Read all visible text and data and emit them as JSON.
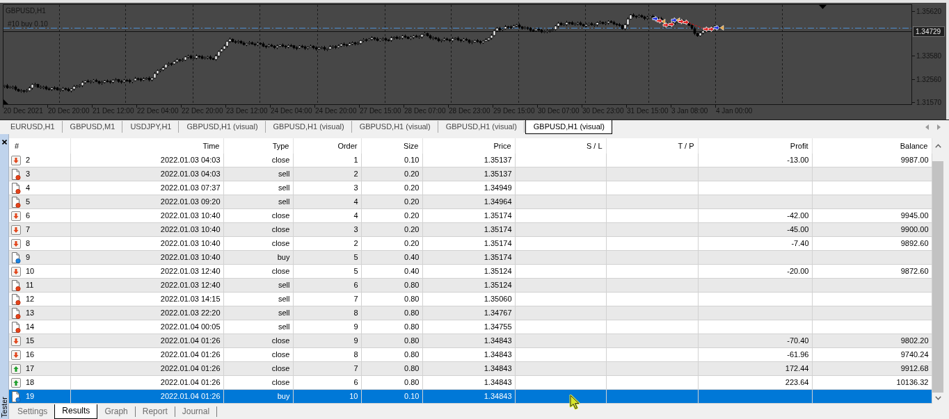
{
  "chart": {
    "symbol_label": "GBPUSD,H1",
    "order_label": "#10 buy 0.10",
    "price_ticks": [
      "1.35620",
      "1.33580",
      "1.32560",
      "1.31570"
    ],
    "current_price": "1.34729",
    "time_labels": [
      "20 Dec 2021",
      "20 Dec 20:00",
      "21 Dec 12:00",
      "22 Dec 04:00",
      "22 Dec 20:00",
      "23 Dec 12:00",
      "24 Dec 04:00",
      "24 Dec 20:00",
      "27 Dec 15:00",
      "28 Dec 07:00",
      "28 Dec 23:00",
      "29 Dec 15:00",
      "30 Dec 07:00",
      "30 Dec 23:00",
      "31 Dec 15:00",
      "3 Jan 08:00",
      "4 Jan 00:00"
    ]
  },
  "chart_tabs": [
    {
      "label": "EURUSD,H1",
      "selected": false
    },
    {
      "label": "GBPUSD,M1",
      "selected": false
    },
    {
      "label": "USDJPY,H1",
      "selected": false
    },
    {
      "label": "GBPUSD,H1 (visual)",
      "selected": false
    },
    {
      "label": "GBPUSD,H1 (visual)",
      "selected": false
    },
    {
      "label": "GBPUSD,H1 (visual)",
      "selected": false
    },
    {
      "label": "GBPUSD,H1 (visual)",
      "selected": false
    },
    {
      "label": "GBPUSD,H1 (visual)",
      "selected": true
    }
  ],
  "tester": {
    "title": "Tester",
    "columns": [
      "#",
      "Time",
      "Type",
      "Order",
      "Size",
      "Price",
      "S / L",
      "T / P",
      "Profit",
      "Balance"
    ],
    "rows": [
      {
        "kind": "loss",
        "number": "2",
        "time": "2022.01.03 04:03",
        "type": "close",
        "order": "1",
        "size": "0.10",
        "price": "1.35137",
        "profit": "-13.00",
        "balance": "9987.00",
        "selected": false
      },
      {
        "kind": "sell",
        "number": "3",
        "time": "2022.01.03 04:03",
        "type": "sell",
        "order": "2",
        "size": "0.20",
        "price": "1.35137",
        "selected": false
      },
      {
        "kind": "sell",
        "number": "4",
        "time": "2022.01.03 07:37",
        "type": "sell",
        "order": "3",
        "size": "0.20",
        "price": "1.34949",
        "selected": false
      },
      {
        "kind": "sell",
        "number": "5",
        "time": "2022.01.03 09:20",
        "type": "sell",
        "order": "4",
        "size": "0.20",
        "price": "1.34964",
        "selected": false
      },
      {
        "kind": "loss",
        "number": "6",
        "time": "2022.01.03 10:40",
        "type": "close",
        "order": "4",
        "size": "0.20",
        "price": "1.35174",
        "profit": "-42.00",
        "balance": "9945.00",
        "selected": false
      },
      {
        "kind": "loss",
        "number": "7",
        "time": "2022.01.03 10:40",
        "type": "close",
        "order": "3",
        "size": "0.20",
        "price": "1.35174",
        "profit": "-45.00",
        "balance": "9900.00",
        "selected": false
      },
      {
        "kind": "loss",
        "number": "8",
        "time": "2022.01.03 10:40",
        "type": "close",
        "order": "2",
        "size": "0.20",
        "price": "1.35174",
        "profit": "-7.40",
        "balance": "9892.60",
        "selected": false
      },
      {
        "kind": "buy",
        "number": "9",
        "time": "2022.01.03 10:40",
        "type": "buy",
        "order": "5",
        "size": "0.40",
        "price": "1.35174",
        "selected": false
      },
      {
        "kind": "loss",
        "number": "10",
        "time": "2022.01.03 12:40",
        "type": "close",
        "order": "5",
        "size": "0.40",
        "price": "1.35124",
        "profit": "-20.00",
        "balance": "9872.60",
        "selected": false
      },
      {
        "kind": "sell",
        "number": "11",
        "time": "2022.01.03 12:40",
        "type": "sell",
        "order": "6",
        "size": "0.80",
        "price": "1.35124",
        "selected": false
      },
      {
        "kind": "sell",
        "number": "12",
        "time": "2022.01.03 14:15",
        "type": "sell",
        "order": "7",
        "size": "0.80",
        "price": "1.35060",
        "selected": false
      },
      {
        "kind": "sell",
        "number": "13",
        "time": "2022.01.03 22:20",
        "type": "sell",
        "order": "8",
        "size": "0.80",
        "price": "1.34767",
        "selected": false
      },
      {
        "kind": "sell",
        "number": "14",
        "time": "2022.01.04 00:05",
        "type": "sell",
        "order": "9",
        "size": "0.80",
        "price": "1.34755",
        "selected": false
      },
      {
        "kind": "loss",
        "number": "15",
        "time": "2022.01.04 01:26",
        "type": "close",
        "order": "9",
        "size": "0.80",
        "price": "1.34843",
        "profit": "-70.40",
        "balance": "9802.20",
        "selected": false
      },
      {
        "kind": "loss",
        "number": "16",
        "time": "2022.01.04 01:26",
        "type": "close",
        "order": "8",
        "size": "0.80",
        "price": "1.34843",
        "profit": "-61.96",
        "balance": "9740.24",
        "selected": false
      },
      {
        "kind": "gain",
        "number": "17",
        "time": "2022.01.04 01:26",
        "type": "close",
        "order": "7",
        "size": "0.80",
        "price": "1.34843",
        "profit": "172.44",
        "balance": "9912.68",
        "selected": false
      },
      {
        "kind": "gain",
        "number": "18",
        "time": "2022.01.04 01:26",
        "type": "close",
        "order": "6",
        "size": "0.80",
        "price": "1.34843",
        "profit": "223.64",
        "balance": "10136.32",
        "selected": false
      },
      {
        "kind": "buy",
        "number": "19",
        "time": "2022.01.04 01:26",
        "type": "buy",
        "order": "10",
        "size": "0.10",
        "price": "1.34843",
        "selected": true
      }
    ],
    "tabs": [
      {
        "label": "Settings",
        "selected": false
      },
      {
        "label": "Results",
        "selected": true
      },
      {
        "label": "Graph",
        "selected": false
      },
      {
        "label": "Report",
        "selected": false
      },
      {
        "label": "Journal",
        "selected": false
      }
    ]
  }
}
